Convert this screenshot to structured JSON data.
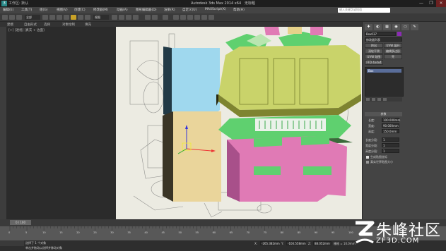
{
  "window": {
    "title": "Autodesk 3ds Max 2014 x64",
    "title_right": "无标题",
    "left_menu_label": "工作区: 默认",
    "min": "—",
    "max": "❐",
    "close": "✕"
  },
  "menu": [
    "编辑(E)",
    "工具(T)",
    "组(G)",
    "视图(V)",
    "创建(C)",
    "修改器(M)",
    "动画(A)",
    "图形编辑器(D)",
    "渲染(R)",
    "自定义(U)",
    "MAXScript(X)",
    "帮助(H)"
  ],
  "toolbar": {
    "select_filter": "全部",
    "view_dropdown": "视图",
    "search_placeholder": "键入关键字或短语"
  },
  "ribbon": {
    "tabs": [
      "建模",
      "自由形式",
      "选择",
      "对象绘制",
      "填充"
    ]
  },
  "viewport": {
    "label": "[+] [透视] [真实 + 边面]",
    "colors": {
      "cyan_box": "#9fd8ee",
      "tan_box": "#ead59b",
      "olive": "#c9d36a",
      "green": "#5fd06f",
      "pink": "#e07ab5",
      "white": "#f0f0ea"
    }
  },
  "cmdpanel": {
    "tabs": [
      "✚",
      "◐",
      "▦",
      "◉",
      "▭",
      "✎"
    ],
    "object_name": "Box037",
    "modifier_list": "修改器列表",
    "buttons": [
      "挤出",
      "UVW 展开",
      "涡轮平滑",
      "编辑多边形",
      "UVW 贴图",
      "壳"
    ],
    "ffd_label": "FFD 4x4x4",
    "stack_item": "Box",
    "params_title": "参数",
    "fields": [
      {
        "label": "长度:",
        "value": "100.000mm"
      },
      {
        "label": "宽度:",
        "value": "90.000mm"
      },
      {
        "label": "高度:",
        "value": "150.0mm"
      },
      {
        "label": "长度分段:",
        "value": "1"
      },
      {
        "label": "宽度分段:",
        "value": "1"
      },
      {
        "label": "高度分段:",
        "value": "1"
      }
    ],
    "check1": "生成贴图坐标",
    "check2": "真实世界贴图大小"
  },
  "timeline": {
    "slider": "0 / 100",
    "ticks": [
      "0",
      "5",
      "10",
      "15",
      "20",
      "25",
      "30",
      "35",
      "40",
      "45",
      "50",
      "55",
      "60",
      "65",
      "70",
      "75",
      "80",
      "85",
      "90",
      "95",
      "100"
    ]
  },
  "status": {
    "line1": "选择了 1 个对象",
    "line2": "单击并拖动以选择并移动对象",
    "x_label": "X:",
    "x_value": "-265.382mm",
    "y_label": "Y:",
    "y_value": "-104.558mm",
    "z_label": "Z:",
    "z_value": "88.052mm",
    "grid": "栅格 = 10.0mm",
    "anim_label": "自动关键点",
    "set_key": "设置关键点"
  },
  "watermark": {
    "brand": "朱峰社区",
    "url": "ZF3D.COM"
  }
}
